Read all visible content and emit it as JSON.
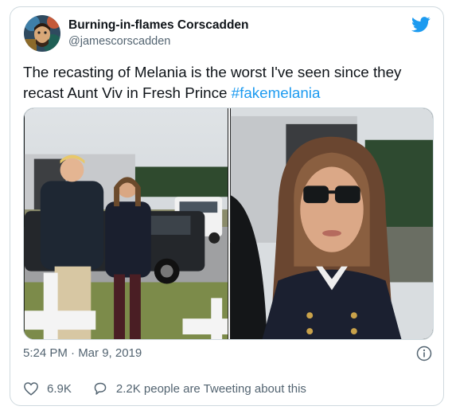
{
  "author": {
    "display_name": "Burning-in-flames Corscadden",
    "handle": "@jamescorscadden"
  },
  "tweet": {
    "text": "The recasting of Melania is the worst I've seen since they recast Aunt Viv in Fresh Prince ",
    "hashtag": "#fakemelania",
    "timestamp": "5:24 PM · Mar 9, 2019"
  },
  "actions": {
    "likes": "6.9K",
    "replies_text": "2.2K people are Tweeting about this"
  },
  "colors": {
    "accent": "#1d9bf0",
    "text": "#0f1419",
    "muted": "#536471"
  },
  "icons": {
    "brand": "twitter-bird-icon",
    "info": "info-icon",
    "like": "heart-icon",
    "reply": "comment-bubble-icon"
  }
}
